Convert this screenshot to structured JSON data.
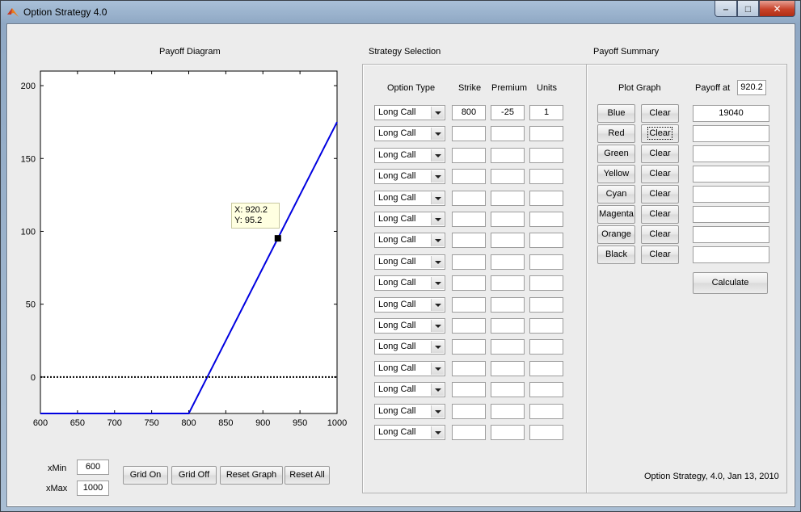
{
  "window": {
    "title": "Option Strategy 4.0",
    "min": "–",
    "max": "□",
    "close": "✕"
  },
  "payoff_diagram": {
    "title": "Payoff Diagram",
    "datatip": {
      "x": "X: 920.2",
      "y": "Y: 95.2"
    },
    "xticks": [
      "600",
      "650",
      "700",
      "750",
      "800",
      "850",
      "900",
      "950",
      "1000"
    ],
    "yticks": [
      "200",
      "150",
      "100",
      "50",
      "0"
    ],
    "xmin_label": "xMin",
    "xmin_value": "600",
    "xmax_label": "xMax",
    "xmax_value": "1000",
    "buttons": {
      "grid_on": "Grid On",
      "grid_off": "Grid Off",
      "reset_graph": "Reset Graph",
      "reset_all": "Reset All"
    }
  },
  "chart_data": {
    "type": "line",
    "title": "Payoff Diagram",
    "xlim": [
      600,
      1000
    ],
    "ylim": [
      -25,
      210
    ],
    "series": [
      {
        "color": "#0000e0",
        "x": [
          600,
          800,
          1000
        ],
        "y": [
          -25,
          -25,
          175
        ]
      },
      {
        "color": "#000000",
        "style": "dotted",
        "x": [
          600,
          1000
        ],
        "y": [
          0,
          0
        ]
      }
    ],
    "marker": {
      "x": 920.2,
      "y": 95.2
    },
    "grid": false
  },
  "strategy_selection": {
    "title": "Strategy Selection",
    "headers": {
      "type": "Option Type",
      "strike": "Strike",
      "premium": "Premium",
      "units": "Units"
    },
    "rows": [
      {
        "type": "Long Call",
        "strike": "800",
        "premium": "-25",
        "units": "1"
      },
      {
        "type": "Long Call",
        "strike": "",
        "premium": "",
        "units": ""
      },
      {
        "type": "Long Call",
        "strike": "",
        "premium": "",
        "units": ""
      },
      {
        "type": "Long Call",
        "strike": "",
        "premium": "",
        "units": ""
      },
      {
        "type": "Long Call",
        "strike": "",
        "premium": "",
        "units": ""
      },
      {
        "type": "Long Call",
        "strike": "",
        "premium": "",
        "units": ""
      },
      {
        "type": "Long Call",
        "strike": "",
        "premium": "",
        "units": ""
      },
      {
        "type": "Long Call",
        "strike": "",
        "premium": "",
        "units": ""
      },
      {
        "type": "Long Call",
        "strike": "",
        "premium": "",
        "units": ""
      },
      {
        "type": "Long Call",
        "strike": "",
        "premium": "",
        "units": ""
      },
      {
        "type": "Long Call",
        "strike": "",
        "premium": "",
        "units": ""
      },
      {
        "type": "Long Call",
        "strike": "",
        "premium": "",
        "units": ""
      },
      {
        "type": "Long Call",
        "strike": "",
        "premium": "",
        "units": ""
      },
      {
        "type": "Long Call",
        "strike": "",
        "premium": "",
        "units": ""
      },
      {
        "type": "Long Call",
        "strike": "",
        "premium": "",
        "units": ""
      },
      {
        "type": "Long Call",
        "strike": "",
        "premium": "",
        "units": ""
      }
    ]
  },
  "payoff_summary": {
    "title": "Payoff Summary",
    "plot_graph_label": "Plot Graph",
    "payoff_at_label": "Payoff at",
    "payoff_at_value": "920.2",
    "rows": [
      {
        "color": "Blue",
        "clear": "Clear",
        "value": "19040"
      },
      {
        "color": "Red",
        "clear": "Clear",
        "value": ""
      },
      {
        "color": "Green",
        "clear": "Clear",
        "value": ""
      },
      {
        "color": "Yellow",
        "clear": "Clear",
        "value": ""
      },
      {
        "color": "Cyan",
        "clear": "Clear",
        "value": ""
      },
      {
        "color": "Magenta",
        "clear": "Clear",
        "value": ""
      },
      {
        "color": "Orange",
        "clear": "Clear",
        "value": ""
      },
      {
        "color": "Black",
        "clear": "Clear",
        "value": ""
      }
    ],
    "calculate": "Calculate",
    "footer": "Option Strategy, 4.0, Jan 13, 2010"
  }
}
